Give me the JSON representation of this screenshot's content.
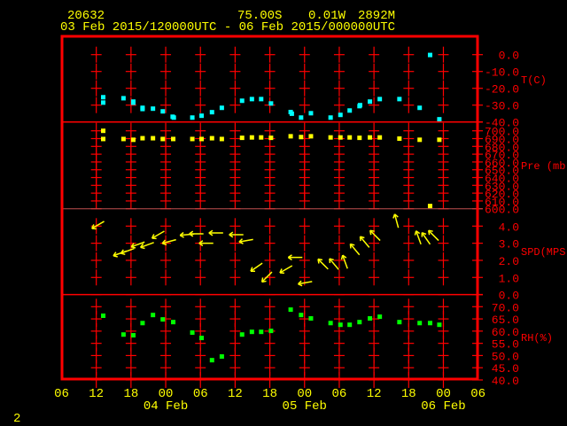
{
  "header": {
    "station": "20632",
    "lat": "75.00S",
    "lon": "0.01W",
    "elev": "2892M",
    "range": "03 Feb 2015/120000UTC - 06 Feb 2015/000000UTC"
  },
  "page_number": "2",
  "colors": {
    "frame": "#ff0000",
    "text": "#ffff00",
    "temp": "#00ffff",
    "pres": "#ffff00",
    "wind": "#ffff00",
    "rh": "#00ff00"
  },
  "chart_data": {
    "type": "scatter",
    "x_units": "hours since 03 Feb 2015 06 UTC",
    "xlim": [
      0,
      72
    ],
    "x_ticks": [
      {
        "h": 0,
        "label": "06"
      },
      {
        "h": 6,
        "label": "12"
      },
      {
        "h": 12,
        "label": "18"
      },
      {
        "h": 18,
        "label": "00"
      },
      {
        "h": 24,
        "label": "06"
      },
      {
        "h": 30,
        "label": "12"
      },
      {
        "h": 36,
        "label": "18"
      },
      {
        "h": 42,
        "label": "00"
      },
      {
        "h": 48,
        "label": "06"
      },
      {
        "h": 54,
        "label": "12"
      },
      {
        "h": 60,
        "label": "18"
      },
      {
        "h": 66,
        "label": "00"
      },
      {
        "h": 72,
        "label": "06"
      }
    ],
    "date_labels": [
      {
        "h": 18,
        "label": "04 Feb"
      },
      {
        "h": 42,
        "label": "05 Feb"
      },
      {
        "h": 66,
        "label": "06 Feb"
      }
    ],
    "panels": [
      {
        "name": "temperature",
        "label": "T(C)",
        "ylim": [
          -40,
          5
        ],
        "ticks": [
          "0.0",
          "-10.0",
          "-20.0",
          "-30.0",
          "-40.0"
        ],
        "tick_values": [
          0,
          -10,
          -20,
          -30,
          -40
        ],
        "points": [
          [
            7.2,
            -25.3
          ],
          [
            7.2,
            -28.5
          ],
          [
            10.7,
            -25.9
          ],
          [
            12.4,
            -27.9
          ],
          [
            12.4,
            -28.6
          ],
          [
            14.0,
            -31.6
          ],
          [
            14.0,
            -32.3
          ],
          [
            15.8,
            -32.1
          ],
          [
            17.5,
            -33.7
          ],
          [
            19.2,
            -36.9
          ],
          [
            19.4,
            -37.4
          ],
          [
            22.6,
            -37.4
          ],
          [
            24.2,
            -36.3
          ],
          [
            26.0,
            -34.2
          ],
          [
            27.7,
            -31.6
          ],
          [
            31.2,
            -27.4
          ],
          [
            32.9,
            -26.4
          ],
          [
            34.5,
            -26.4
          ],
          [
            36.2,
            -29.0
          ],
          [
            39.6,
            -34.1
          ],
          [
            39.8,
            -35.1
          ],
          [
            41.4,
            -37.4
          ],
          [
            43.1,
            -34.8
          ],
          [
            46.5,
            -37.4
          ],
          [
            48.2,
            -35.8
          ],
          [
            49.8,
            -33.2
          ],
          [
            51.5,
            -30.6
          ],
          [
            51.6,
            -30.0
          ],
          [
            53.3,
            -27.9
          ],
          [
            55.0,
            -26.4
          ],
          [
            58.4,
            -26.4
          ],
          [
            61.9,
            -31.6
          ],
          [
            63.7,
            -0.2
          ],
          [
            65.3,
            -38.4
          ]
        ]
      },
      {
        "name": "pressure",
        "label": "Pre (mb)",
        "ylim": [
          600,
          705
        ],
        "ticks": [
          "700.0",
          "690.0",
          "680.0",
          "670.0",
          "660.0",
          "650.0",
          "640.0",
          "630.0",
          "620.0",
          "610.0",
          "600.0"
        ],
        "tick_values": [
          700,
          690,
          680,
          670,
          660,
          650,
          640,
          630,
          620,
          610,
          600
        ],
        "points": [
          [
            7.2,
            700
          ],
          [
            7.2,
            689.5
          ],
          [
            10.7,
            689.5
          ],
          [
            12.4,
            688.5
          ],
          [
            14.0,
            690.5
          ],
          [
            15.8,
            690.5
          ],
          [
            17.5,
            689.5
          ],
          [
            19.3,
            689.5
          ],
          [
            22.6,
            689.5
          ],
          [
            24.2,
            689.5
          ],
          [
            26.0,
            690.5
          ],
          [
            27.7,
            689.5
          ],
          [
            31.2,
            691
          ],
          [
            32.9,
            691.5
          ],
          [
            34.5,
            691.5
          ],
          [
            36.2,
            691
          ],
          [
            39.6,
            693
          ],
          [
            41.4,
            692
          ],
          [
            43.1,
            693
          ],
          [
            46.5,
            691.5
          ],
          [
            48.2,
            691.5
          ],
          [
            49.8,
            691.5
          ],
          [
            51.5,
            691
          ],
          [
            53.3,
            691.5
          ],
          [
            55.0,
            691.5
          ],
          [
            58.4,
            690
          ],
          [
            61.9,
            688.5
          ],
          [
            63.7,
            603.5
          ],
          [
            65.3,
            688.5
          ]
        ]
      },
      {
        "name": "wind_speed",
        "label": "SPD(MPS)",
        "ylim": [
          0,
          4.7
        ],
        "ticks": [
          "4.0",
          "3.0",
          "2.0",
          "1.0",
          "0.0"
        ],
        "tick_values": [
          4,
          3,
          2,
          1,
          0
        ],
        "arrows_note": "each point: [hour, speed m/s, arrow pointing direction in degrees (0=right, 90=up)]",
        "points": [
          [
            6.3,
            4.07,
            210
          ],
          [
            10.1,
            2.41,
            200
          ],
          [
            11.4,
            2.55,
            200
          ],
          [
            13.2,
            2.93,
            200
          ],
          [
            14.8,
            2.9,
            200
          ],
          [
            16.7,
            3.5,
            210
          ],
          [
            18.6,
            3.1,
            195
          ],
          [
            21.7,
            3.5,
            185
          ],
          [
            23.3,
            3.55,
            180
          ],
          [
            25.0,
            3.0,
            180
          ],
          [
            26.7,
            3.6,
            180
          ],
          [
            30.2,
            3.5,
            180
          ],
          [
            31.9,
            3.15,
            190
          ],
          [
            33.7,
            1.6,
            215
          ],
          [
            35.5,
            1.03,
            225
          ],
          [
            38.8,
            1.48,
            210
          ],
          [
            40.4,
            2.17,
            180
          ],
          [
            42.1,
            0.69,
            190
          ],
          [
            45.2,
            1.78,
            135
          ],
          [
            47.1,
            1.78,
            130
          ],
          [
            49.0,
            1.91,
            110
          ],
          [
            50.7,
            2.64,
            130
          ],
          [
            52.4,
            3.07,
            130
          ],
          [
            54.2,
            3.45,
            135
          ],
          [
            57.9,
            4.3,
            105
          ],
          [
            61.7,
            3.33,
            110
          ],
          [
            63.0,
            3.28,
            125
          ],
          [
            64.3,
            3.45,
            135
          ]
        ]
      },
      {
        "name": "relative_humidity",
        "label": "RH(%)",
        "ylim": [
          40,
          72
        ],
        "ticks": [
          "70.0",
          "65.0",
          "60.0",
          "55.0",
          "50.0",
          "45.0",
          "40.0"
        ],
        "tick_values": [
          70,
          65,
          60,
          55,
          50,
          45,
          40
        ],
        "points": [
          [
            7.2,
            66.3
          ],
          [
            10.7,
            58.6
          ],
          [
            12.4,
            58.3
          ],
          [
            14.0,
            63.3
          ],
          [
            15.8,
            66.6
          ],
          [
            17.5,
            64.8
          ],
          [
            19.3,
            63.7
          ],
          [
            22.6,
            59.4
          ],
          [
            24.2,
            57.2
          ],
          [
            26.0,
            48.1
          ],
          [
            27.7,
            49.6
          ],
          [
            31.2,
            58.6
          ],
          [
            32.9,
            59.7
          ],
          [
            34.5,
            59.7
          ],
          [
            36.2,
            60.1
          ],
          [
            39.6,
            68.8
          ],
          [
            41.4,
            66.6
          ],
          [
            43.1,
            65.2
          ],
          [
            46.5,
            63.3
          ],
          [
            48.2,
            62.6
          ],
          [
            49.8,
            62.6
          ],
          [
            51.5,
            63.7
          ],
          [
            53.3,
            65.2
          ],
          [
            55.0,
            65.9
          ],
          [
            58.4,
            63.7
          ],
          [
            61.9,
            63.3
          ],
          [
            63.7,
            63.3
          ],
          [
            65.3,
            62.6
          ]
        ]
      }
    ]
  }
}
